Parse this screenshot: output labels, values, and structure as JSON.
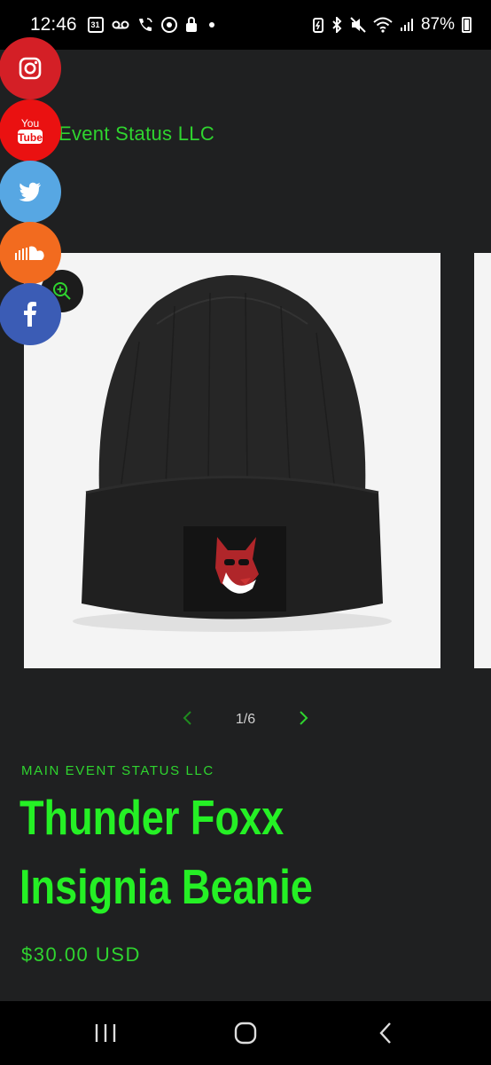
{
  "status_bar": {
    "time": "12:46",
    "calendar_day": "31",
    "battery_percent": "87%"
  },
  "store": {
    "title": "Event Status LLC"
  },
  "social": [
    {
      "name": "Instagram",
      "color": "#d41f26"
    },
    {
      "name": "YouTube",
      "color": "#ea1111",
      "icon_text_top": "You",
      "icon_text_bottom": "Tube"
    },
    {
      "name": "Twitter",
      "color": "#57a7e3"
    },
    {
      "name": "SoundCloud",
      "color": "#f26b1f"
    },
    {
      "name": "Facebook",
      "color": "#3b5cb5"
    }
  ],
  "gallery": {
    "counter": "1/6",
    "prev_icon": "chevron-left-icon",
    "next_icon": "chevron-right-icon",
    "zoom_icon": "zoom-in-icon"
  },
  "product": {
    "vendor": "MAIN EVENT STATUS LLC",
    "title_line1": "Thunder Foxx",
    "title_line2": "Insignia Beanie",
    "price": "$30.00 USD"
  },
  "colors": {
    "accent": "#2fd42f",
    "title_green": "#25f025",
    "background": "#1f2021"
  }
}
